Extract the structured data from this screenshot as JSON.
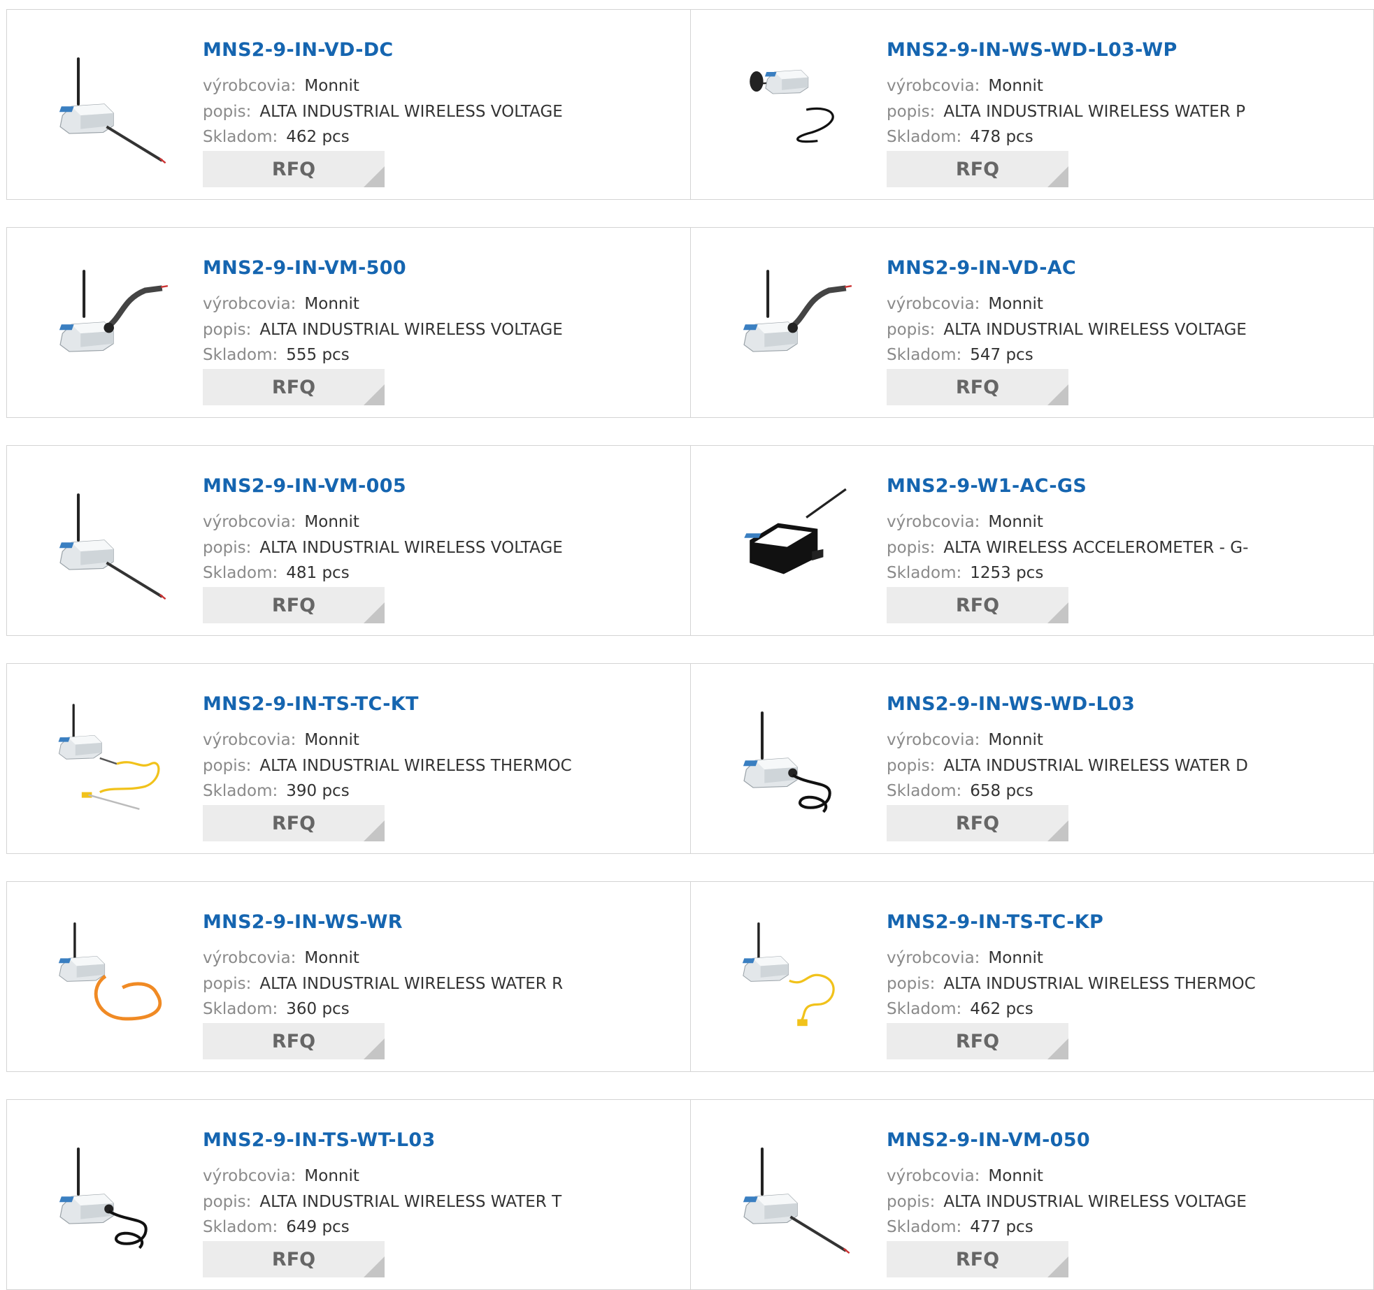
{
  "labels": {
    "manufacturer": "výrobcovia:",
    "description": "popis:",
    "stock": "Skladom:",
    "rfq": "RFQ"
  },
  "rows": [
    {
      "cards": [
        {
          "name": "MNS2-9-IN-VD-DC",
          "manufacturer": "Monnit",
          "description": "ALTA INDUSTRIAL WIRELESS VOLTAGE",
          "stock": "462 pcs",
          "image": "voltage-sensor-straight-cable"
        },
        {
          "name": "MNS2-9-IN-WS-WD-L03-WP",
          "manufacturer": "Monnit",
          "description": "ALTA INDUSTRIAL WIRELESS WATER P",
          "stock": "478 pcs",
          "image": "water-probe-sensor"
        }
      ]
    },
    {
      "cards": [
        {
          "name": "MNS2-9-IN-VM-500",
          "manufacturer": "Monnit",
          "description": "ALTA INDUSTRIAL WIRELESS VOLTAGE",
          "stock": "555 pcs",
          "image": "voltage-sensor-bent-cable"
        },
        {
          "name": "MNS2-9-IN-VD-AC",
          "manufacturer": "Monnit",
          "description": "ALTA INDUSTRIAL WIRELESS VOLTAGE",
          "stock": "547 pcs",
          "image": "voltage-sensor-bent-cable"
        }
      ]
    },
    {
      "cards": [
        {
          "name": "MNS2-9-IN-VM-005",
          "manufacturer": "Monnit",
          "description": "ALTA INDUSTRIAL WIRELESS VOLTAGE",
          "stock": "481 pcs",
          "image": "voltage-sensor-straight-cable"
        },
        {
          "name": "MNS2-9-W1-AC-GS",
          "manufacturer": "Monnit",
          "description": "ALTA WIRELESS ACCELEROMETER - G-",
          "stock": "1253 pcs",
          "image": "accelerometer-sensor"
        }
      ]
    },
    {
      "cards": [
        {
          "name": "MNS2-9-IN-TS-TC-KT",
          "manufacturer": "Monnit",
          "description": "ALTA INDUSTRIAL WIRELESS THERMOC",
          "stock": "390 pcs",
          "image": "thermocouple-probe-sensor"
        },
        {
          "name": "MNS2-9-IN-WS-WD-L03",
          "manufacturer": "Monnit",
          "description": "ALTA INDUSTRIAL WIRELESS WATER D",
          "stock": "658 pcs",
          "image": "coiled-black-cable-sensor"
        }
      ]
    },
    {
      "cards": [
        {
          "name": "MNS2-9-IN-WS-WR",
          "manufacturer": "Monnit",
          "description": "ALTA INDUSTRIAL WIRELESS WATER R",
          "stock": "360 pcs",
          "image": "orange-rope-sensor"
        },
        {
          "name": "MNS2-9-IN-TS-TC-KP",
          "manufacturer": "Monnit",
          "description": "ALTA INDUSTRIAL WIRELESS THERMOC",
          "stock": "462 pcs",
          "image": "thermocouple-sensor"
        }
      ]
    },
    {
      "cards": [
        {
          "name": "MNS2-9-IN-TS-WT-L03",
          "manufacturer": "Monnit",
          "description": "ALTA INDUSTRIAL WIRELESS WATER T",
          "stock": "649 pcs",
          "image": "coiled-black-cable-sensor"
        },
        {
          "name": "MNS2-9-IN-VM-050",
          "manufacturer": "Monnit",
          "description": "ALTA INDUSTRIAL WIRELESS VOLTAGE",
          "stock": "477 pcs",
          "image": "voltage-sensor-straight-cable"
        }
      ]
    }
  ]
}
